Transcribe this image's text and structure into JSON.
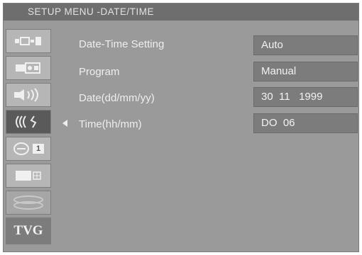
{
  "menu": {
    "title": "SETUP MENU -DATE/TIME"
  },
  "sidebar": {
    "items": [
      {
        "icon": "connection-icon"
      },
      {
        "icon": "camera-icon"
      },
      {
        "icon": "speaker-icon"
      },
      {
        "icon": "signal-waves-icon",
        "selected": true
      },
      {
        "icon": "clock-icon",
        "badge": "1"
      },
      {
        "icon": "display-icon"
      },
      {
        "icon": "disc-icon"
      },
      {
        "icon": "tvg-icon",
        "label": "TVG"
      }
    ]
  },
  "settings": [
    {
      "label": "Date-Time Setting",
      "value": "Auto"
    },
    {
      "label": "Program",
      "value": "Manual"
    },
    {
      "label": "Date(dd/mm/yy)",
      "value": "30  11   1999"
    },
    {
      "label": "Time(hh/mm)",
      "value": "DO  06"
    }
  ],
  "colors": {
    "background": "#9a9a9a",
    "title_bar": "#6e6e6e",
    "value_box": "#7c7c7c",
    "selected_item": "#5a5a5a",
    "text": "#eeeeee"
  }
}
